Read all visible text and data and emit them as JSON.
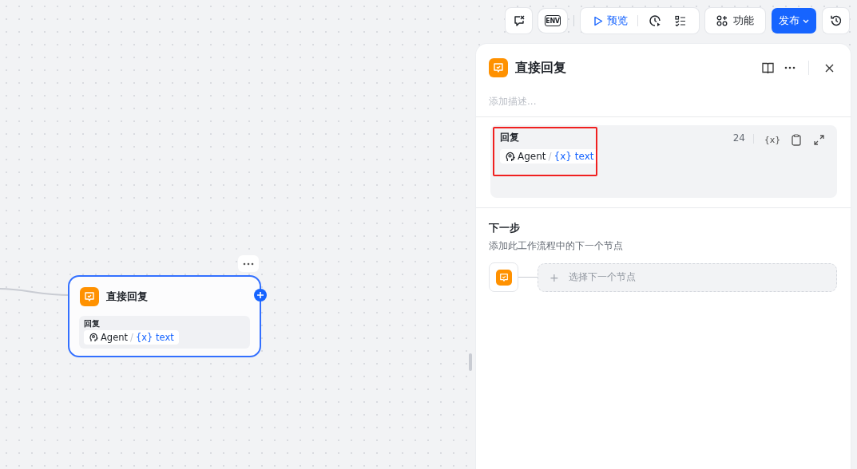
{
  "toolbar": {
    "env_label": "ENV",
    "preview": "预览",
    "features": "功能",
    "publish": "发布"
  },
  "node": {
    "title": "直接回复",
    "selected": true,
    "field_label": "回复",
    "ref": {
      "source": "Agent",
      "separator": "/",
      "var_mark": "{x}",
      "var": "text"
    }
  },
  "panel": {
    "title": "直接回复",
    "description_placeholder": "添加描述...",
    "field": {
      "label": "回复",
      "count": "24",
      "var_button": "{x}",
      "highlighted": true,
      "ref": {
        "source": "Agent",
        "separator": "/",
        "var_mark": "{x}",
        "var": "text"
      }
    },
    "next": {
      "title": "下一步",
      "subtitle": "添加此工作流程中的下一个节点",
      "add_mark": "+",
      "add_label": "选择下一个节点"
    }
  }
}
